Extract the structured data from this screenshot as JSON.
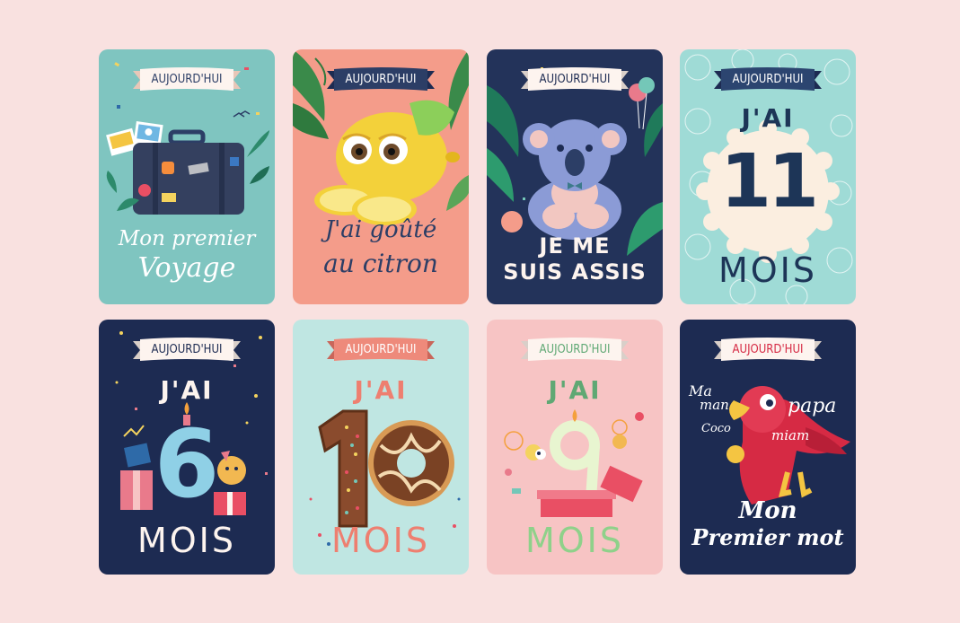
{
  "colors": {
    "page_bg": "#f9e1e0",
    "card1_bg": "#7fc5c0",
    "card2_bg": "#f49c8a",
    "card3_bg": "#23335a",
    "card4_bg": "#9fdbd6",
    "card5_bg": "#1d2b52",
    "card6_bg": "#bfe6e2",
    "card7_bg": "#f7c4c4",
    "card8_bg": "#1d2b52"
  },
  "cards": [
    {
      "banner": "AUJOURD'HUI",
      "line1": "Mon premier",
      "line2": "Voyage",
      "illustration": "suitcase-icon"
    },
    {
      "banner": "AUJOURD'HUI",
      "line1": "J'ai goûté",
      "line2": "au citron",
      "illustration": "lemon-icon"
    },
    {
      "banner": "AUJOURD'HUI",
      "line1": "JE ME",
      "line2": "SUIS ASSIS",
      "illustration": "koala-icon"
    },
    {
      "banner": "AUJOURD'HUI",
      "line1": "J'AI",
      "number": "11",
      "line2": "MOIS"
    },
    {
      "banner": "AUJOURD'HUI",
      "line1": "J'AI",
      "number": "6",
      "line2": "MOIS",
      "illustration": "birthday-gifts-icon"
    },
    {
      "banner": "AUJOURD'HUI",
      "line1": "J'AI",
      "number": "10",
      "line2": "MOIS",
      "illustration": "donut-icon"
    },
    {
      "banner": "AUJOURD'HUI",
      "line1": "J'AI",
      "number": "9",
      "line2": "MOIS",
      "illustration": "gift-box-icon"
    },
    {
      "banner": "AUJOURD'HUI",
      "words": [
        "Ma",
        "man",
        "papa",
        "Coco",
        "miam"
      ],
      "line1": "Mon",
      "line2": "Premier mot",
      "illustration": "parrot-icon"
    }
  ]
}
